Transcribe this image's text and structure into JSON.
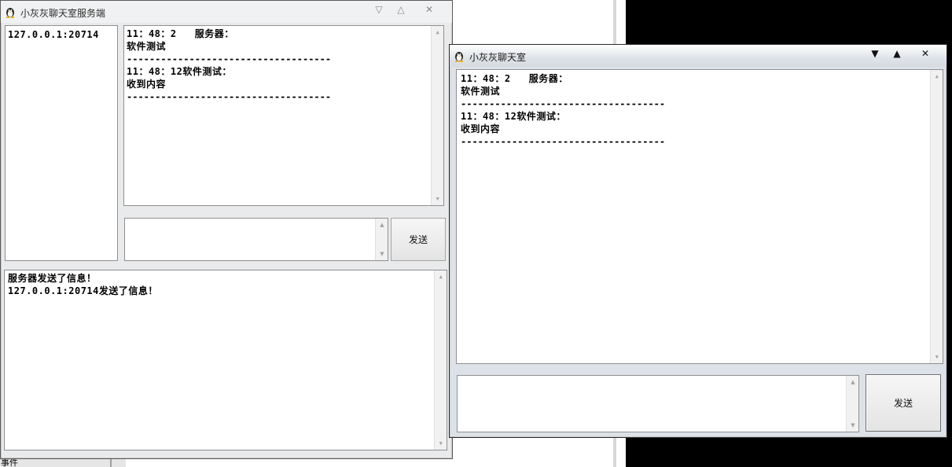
{
  "background": {
    "taskbar_text": "事件"
  },
  "server_window": {
    "title": "小灰灰聊天室服务端",
    "controls": {
      "minimize": "▽",
      "maximize": "△",
      "close": "✕"
    },
    "clients": [
      "127.0.0.1:20714"
    ],
    "messages": [
      {
        "header": "11：48：2   服务器：",
        "body": "软件测试",
        "separator": "------------------------------------"
      },
      {
        "header": "11：48：12软件测试：",
        "body": "收到内容",
        "separator": "------------------------------------"
      }
    ],
    "input_value": "",
    "send_label": "发送",
    "log": [
      "服务器发送了信息！",
      "127.0.0.1:20714发送了信息！"
    ]
  },
  "client_window": {
    "title": "小灰灰聊天室",
    "controls": {
      "minimize": "▼",
      "maximize": "▲",
      "close": "✕"
    },
    "messages": [
      {
        "header": "11：48：2   服务器：",
        "body": "软件测试",
        "separator": "------------------------------------"
      },
      {
        "header": "11：48：12软件测试：",
        "body": "收到内容",
        "separator": "------------------------------------"
      }
    ],
    "input_value": "",
    "send_label": "发送"
  },
  "colors": {
    "accent": "#dde2e8",
    "background": "#000000"
  }
}
